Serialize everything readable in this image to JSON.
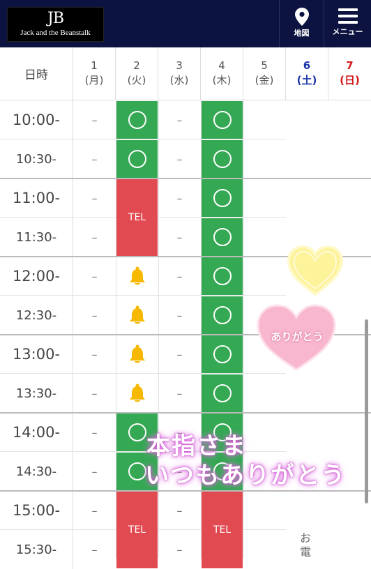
{
  "header": {
    "logo_mark": "JB",
    "logo_name": "Jack and the Beanstalk",
    "map_label": "地図",
    "menu_label": "メニュー"
  },
  "table": {
    "corner_label": "日時",
    "days": [
      {
        "date": "1",
        "weekday": "(月)"
      },
      {
        "date": "2",
        "weekday": "(火)"
      },
      {
        "date": "3",
        "weekday": "(水)"
      },
      {
        "date": "4",
        "weekday": "(木)"
      },
      {
        "date": "5",
        "weekday": "(金)"
      },
      {
        "date": "6",
        "weekday": "(土)"
      },
      {
        "date": "7",
        "weekday": "(日)"
      }
    ],
    "times": [
      "10:00-",
      "10:30-",
      "11:00-",
      "11:30-",
      "12:00-",
      "12:30-",
      "13:00-",
      "13:30-",
      "14:00-",
      "14:30-",
      "15:00-",
      "15:30-"
    ],
    "dash_symbol": "–",
    "tel_label": "TEL"
  },
  "decor": {
    "heart_text": "ありがとう",
    "banner_line1": "本指さま",
    "banner_line2": "いつもありがとう"
  },
  "side_note": "お電",
  "colors": {
    "header_bg": "#0d1340",
    "available_green": "#34a853",
    "tel_red": "#e24a52",
    "bell_yellow": "#f6b800",
    "saturday_blue": "#1a33a8",
    "sunday_red": "#d01b1b"
  },
  "icons": {
    "map": "map-pin-icon",
    "menu": "hamburger-menu-icon",
    "available": "circle-available-icon",
    "waiting": "bell-icon"
  }
}
